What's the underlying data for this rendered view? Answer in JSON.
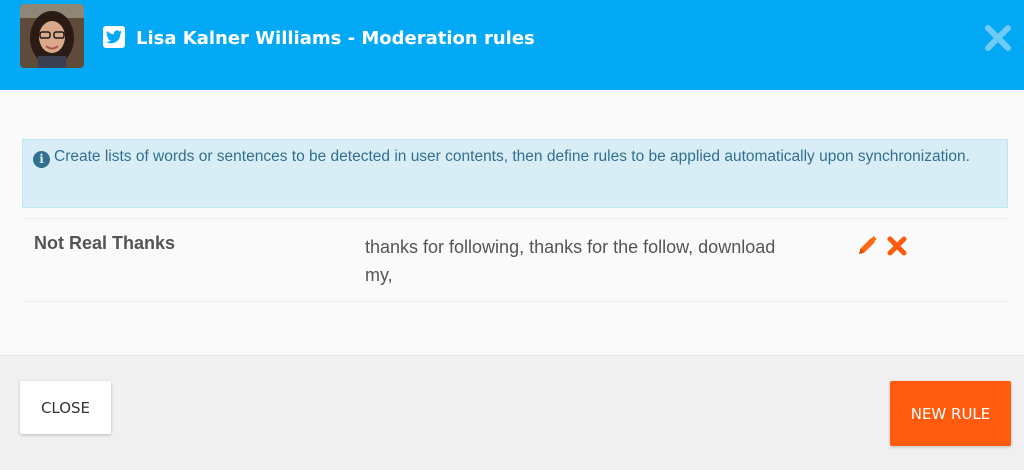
{
  "header": {
    "title": "Lisa Kalner Williams - Moderation rules",
    "service_icon": "twitter-icon",
    "close_icon": "close-icon",
    "color": "#03a9f4"
  },
  "info": {
    "icon": "info-icon",
    "text": "Create lists of words or sentences to be detected in user contents, then define rules to be applied automatically upon synchronization."
  },
  "rules": [
    {
      "name": "Not Real Thanks",
      "words": "thanks for following, thanks for the follow, download my,",
      "actions": [
        "pencil-icon",
        "delete-icon"
      ]
    }
  ],
  "footer": {
    "close_label": "CLOSE",
    "new_rule_label": "NEW RULE",
    "accent_color": "#ff5b0f"
  }
}
